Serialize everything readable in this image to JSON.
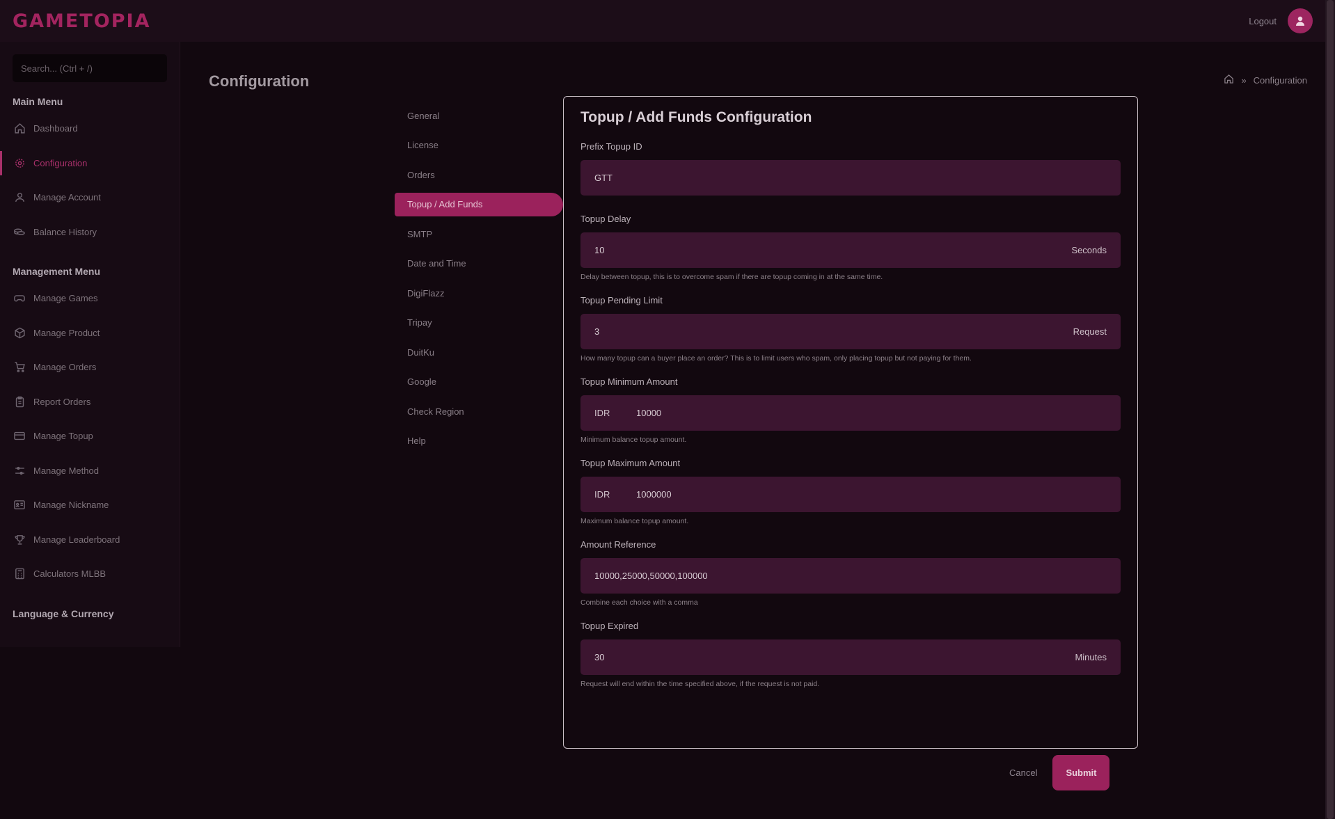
{
  "header": {
    "logo": "GAMETOPIA",
    "logout_label": "Logout"
  },
  "sidebar": {
    "search_placeholder": "Search... (Ctrl + /)",
    "main_menu_title": "Main Menu",
    "main_items": [
      {
        "label": "Dashboard",
        "icon": "home-icon"
      },
      {
        "label": "Configuration",
        "icon": "gear-icon",
        "active": true
      },
      {
        "label": "Manage Account",
        "icon": "user-icon"
      },
      {
        "label": "Balance History",
        "icon": "coins-icon"
      }
    ],
    "management_menu_title": "Management Menu",
    "management_items": [
      {
        "label": "Manage Games",
        "icon": "gamepad-icon"
      },
      {
        "label": "Manage Product",
        "icon": "box-icon"
      },
      {
        "label": "Manage Orders",
        "icon": "cart-icon"
      },
      {
        "label": "Report Orders",
        "icon": "clipboard-icon"
      },
      {
        "label": "Manage Topup",
        "icon": "wallet-icon"
      },
      {
        "label": "Manage Method",
        "icon": "sliders-icon"
      },
      {
        "label": "Manage Nickname",
        "icon": "id-card-icon"
      },
      {
        "label": "Manage Leaderboard",
        "icon": "trophy-icon"
      },
      {
        "label": "Calculators MLBB",
        "icon": "calculator-icon"
      }
    ],
    "language_title": "Language & Currency"
  },
  "page": {
    "title": "Configuration",
    "breadcrumb_current": "Configuration"
  },
  "config_nav": [
    {
      "label": "General"
    },
    {
      "label": "License"
    },
    {
      "label": "Orders"
    },
    {
      "label": "Topup / Add Funds",
      "active": true
    },
    {
      "label": "SMTP"
    },
    {
      "label": "Date and Time"
    },
    {
      "label": "DigiFlazz"
    },
    {
      "label": "Tripay"
    },
    {
      "label": "DuitKu"
    },
    {
      "label": "Google"
    },
    {
      "label": "Check Region"
    },
    {
      "label": "Help"
    }
  ],
  "panel": {
    "title": "Topup / Add Funds Configuration",
    "prefix": {
      "label": "Prefix Topup ID",
      "value": "GTT"
    },
    "delay": {
      "label": "Topup Delay",
      "value": "10",
      "suffix": "Seconds",
      "help": "Delay between topup, this is to overcome spam if there are topup coming in at the same time."
    },
    "pending": {
      "label": "Topup Pending Limit",
      "value": "3",
      "suffix": "Request",
      "help": "How many topup can a buyer place an order? This is to limit users who spam, only placing topup but not paying for them."
    },
    "min": {
      "label": "Topup Minimum Amount",
      "prefix": "IDR",
      "value": "10000",
      "help": "Minimum balance topup amount."
    },
    "max": {
      "label": "Topup Maximum Amount",
      "prefix": "IDR",
      "value": "1000000",
      "help": "Maximum balance topup amount."
    },
    "reference": {
      "label": "Amount Reference",
      "value": "10000,25000,50000,100000",
      "help": "Combine each choice with a comma"
    },
    "expired": {
      "label": "Topup Expired",
      "value": "30",
      "suffix": "Minutes",
      "help": "Request will end within the time specified above, if the request is not paid."
    }
  },
  "actions": {
    "cancel": "Cancel",
    "submit": "Submit"
  },
  "colors": {
    "accent": "#9b225c",
    "background": "#12080f",
    "field": "#3c1530"
  }
}
